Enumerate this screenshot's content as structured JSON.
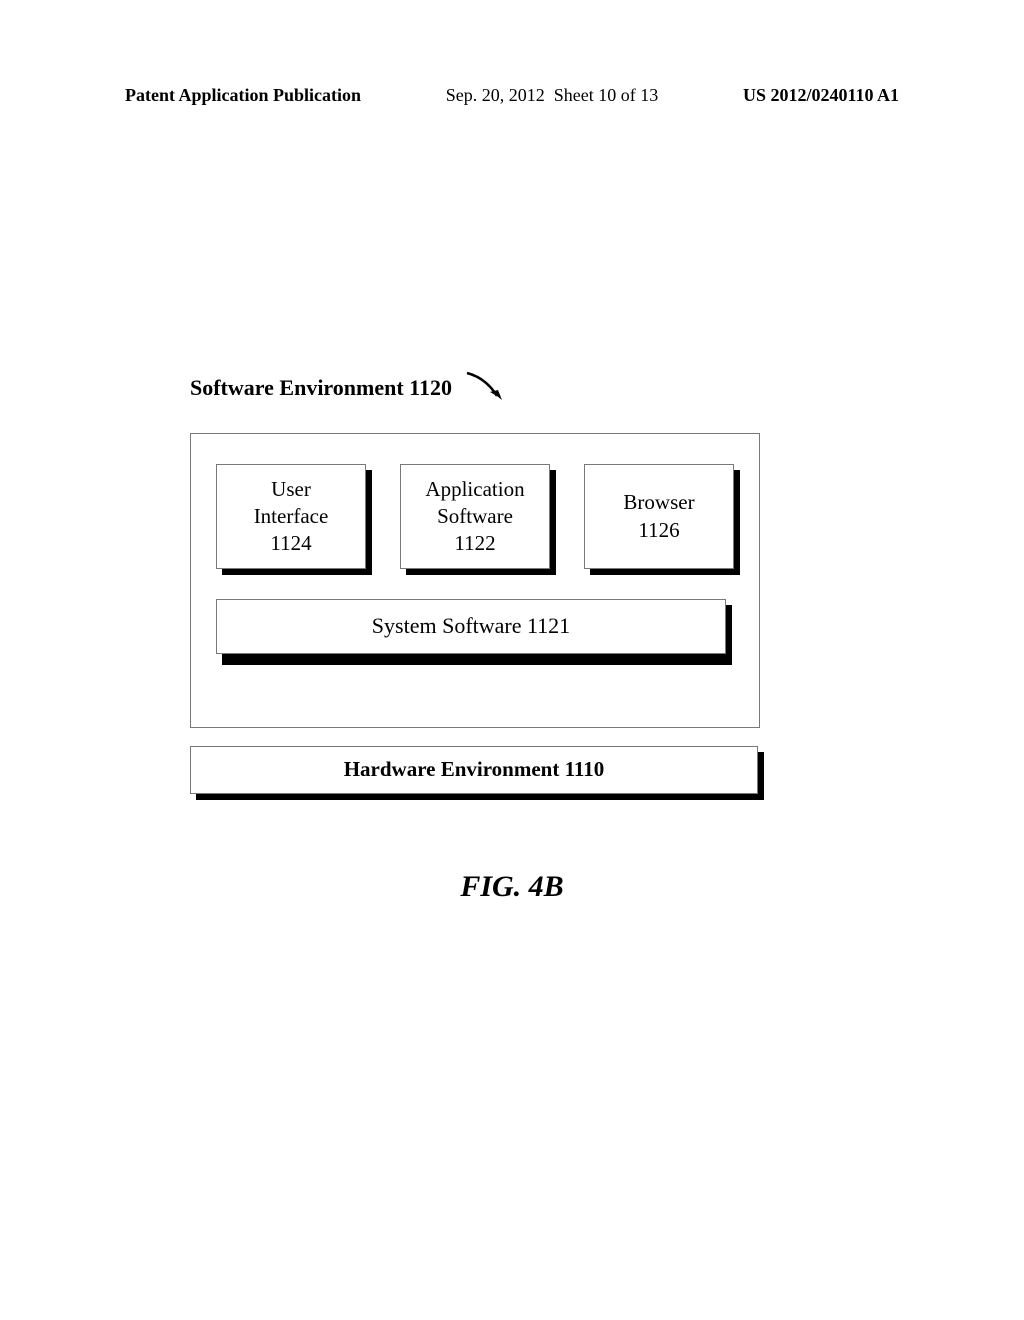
{
  "header": {
    "publication_type": "Patent Application Publication",
    "date": "Sep. 20, 2012",
    "sheet": "Sheet 10 of 13",
    "pub_number": "US 2012/0240110 A1"
  },
  "diagram": {
    "title_label": "Software Environment 1120",
    "boxes": {
      "ui": {
        "line1": "User",
        "line2": "Interface",
        "num": "1124"
      },
      "app": {
        "line1": "Application",
        "line2": "Software",
        "num": "1122"
      },
      "browser": {
        "line1": "Browser",
        "num": "1126"
      },
      "system": "System Software 1121",
      "hardware": "Hardware Environment 1110"
    }
  },
  "figure_label": "FIG. 4B"
}
